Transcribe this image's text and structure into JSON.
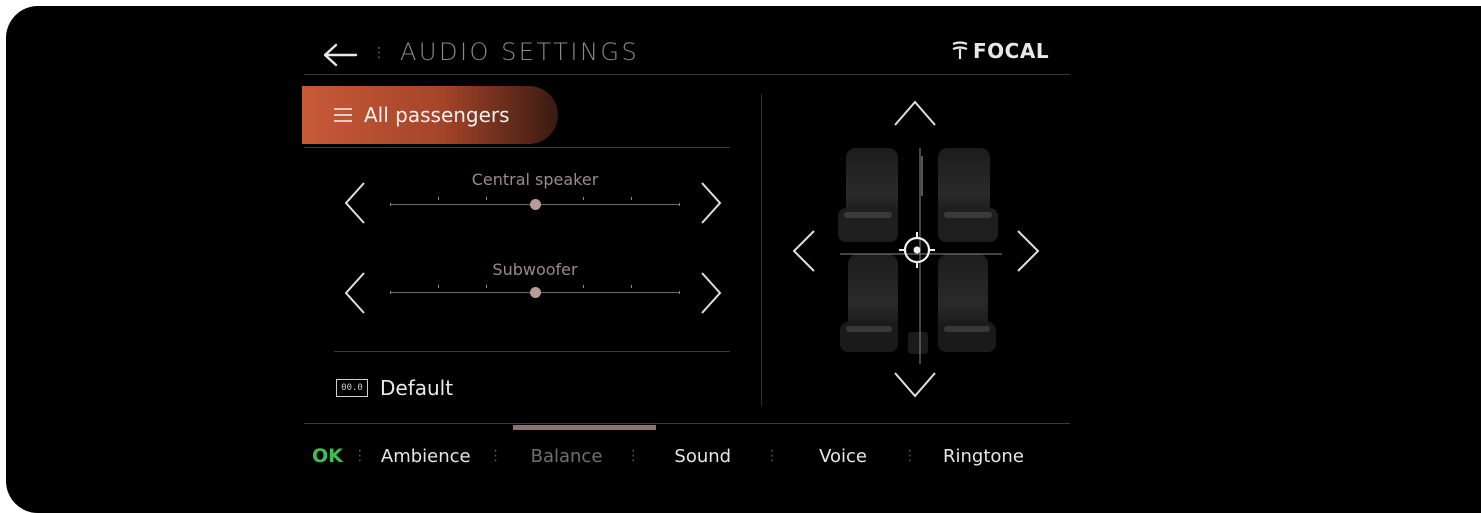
{
  "header": {
    "title": "AUDIO SETTINGS",
    "brand": "FOCAL"
  },
  "zone": {
    "label": "All passengers"
  },
  "sliders": [
    {
      "label": "Central speaker",
      "value": 0
    },
    {
      "label": "Subwoofer",
      "value": 0
    }
  ],
  "default": {
    "icon_text": "00.0",
    "label": "Default"
  },
  "tabs": {
    "ok": "OK",
    "ambience": "Ambience",
    "balance": "Balance",
    "sound": "Sound",
    "voice": "Voice",
    "ringtone": "Ringtone",
    "active": "balance"
  },
  "colors": {
    "accent": "#c75a38",
    "ok": "#3fbf4f",
    "background": "#000000"
  }
}
